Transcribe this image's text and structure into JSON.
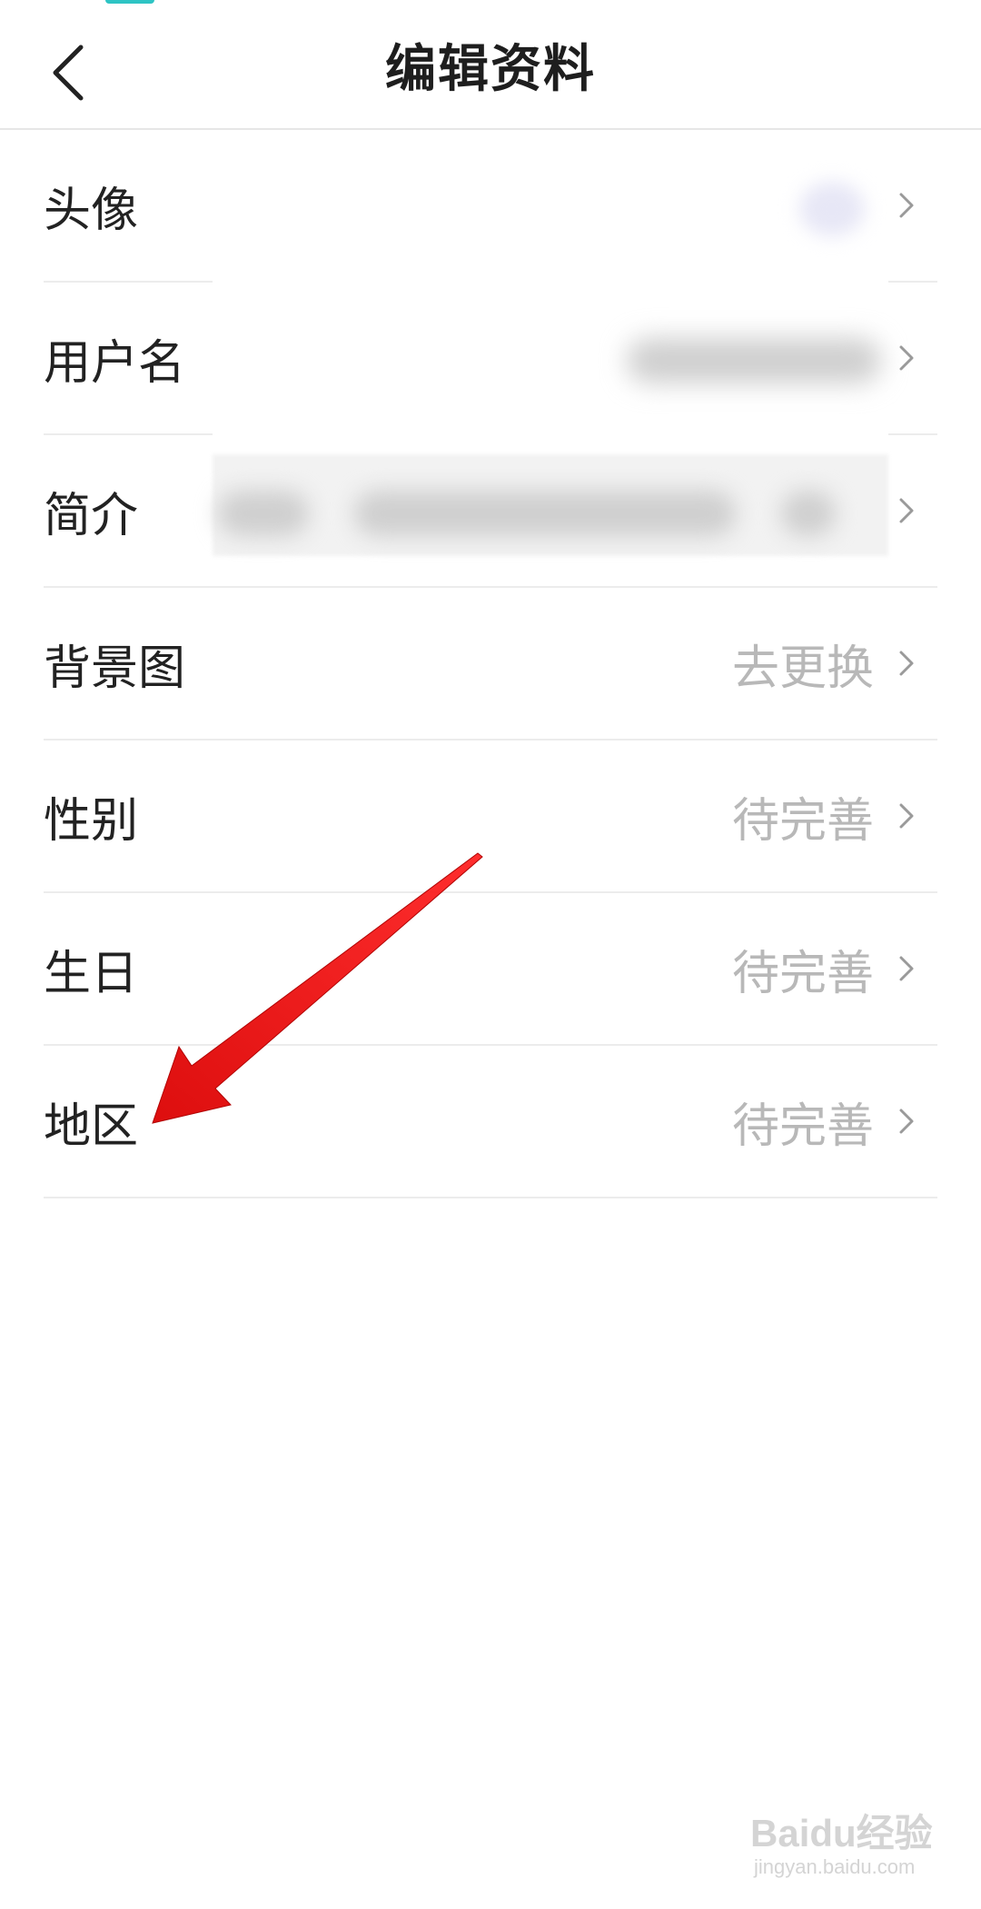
{
  "header": {
    "title": "编辑资料",
    "back_icon": "chevron-left-icon"
  },
  "rows": [
    {
      "label": "头像",
      "value": ""
    },
    {
      "label": "用户名",
      "value": ""
    },
    {
      "label": "简介",
      "value": ""
    },
    {
      "label": "背景图",
      "value": "去更换"
    },
    {
      "label": "性别",
      "value": "待完善"
    },
    {
      "label": "生日",
      "value": "待完善"
    },
    {
      "label": "地区",
      "value": "待完善"
    }
  ],
  "annotation": {
    "arrow_color": "#ee1111"
  },
  "watermark": {
    "main": "Baidu经验",
    "sub": "jingyan.baidu.com"
  },
  "colors": {
    "accent": "#2ec4c4",
    "value_text": "#b8b8b8",
    "divider": "#ececec"
  }
}
